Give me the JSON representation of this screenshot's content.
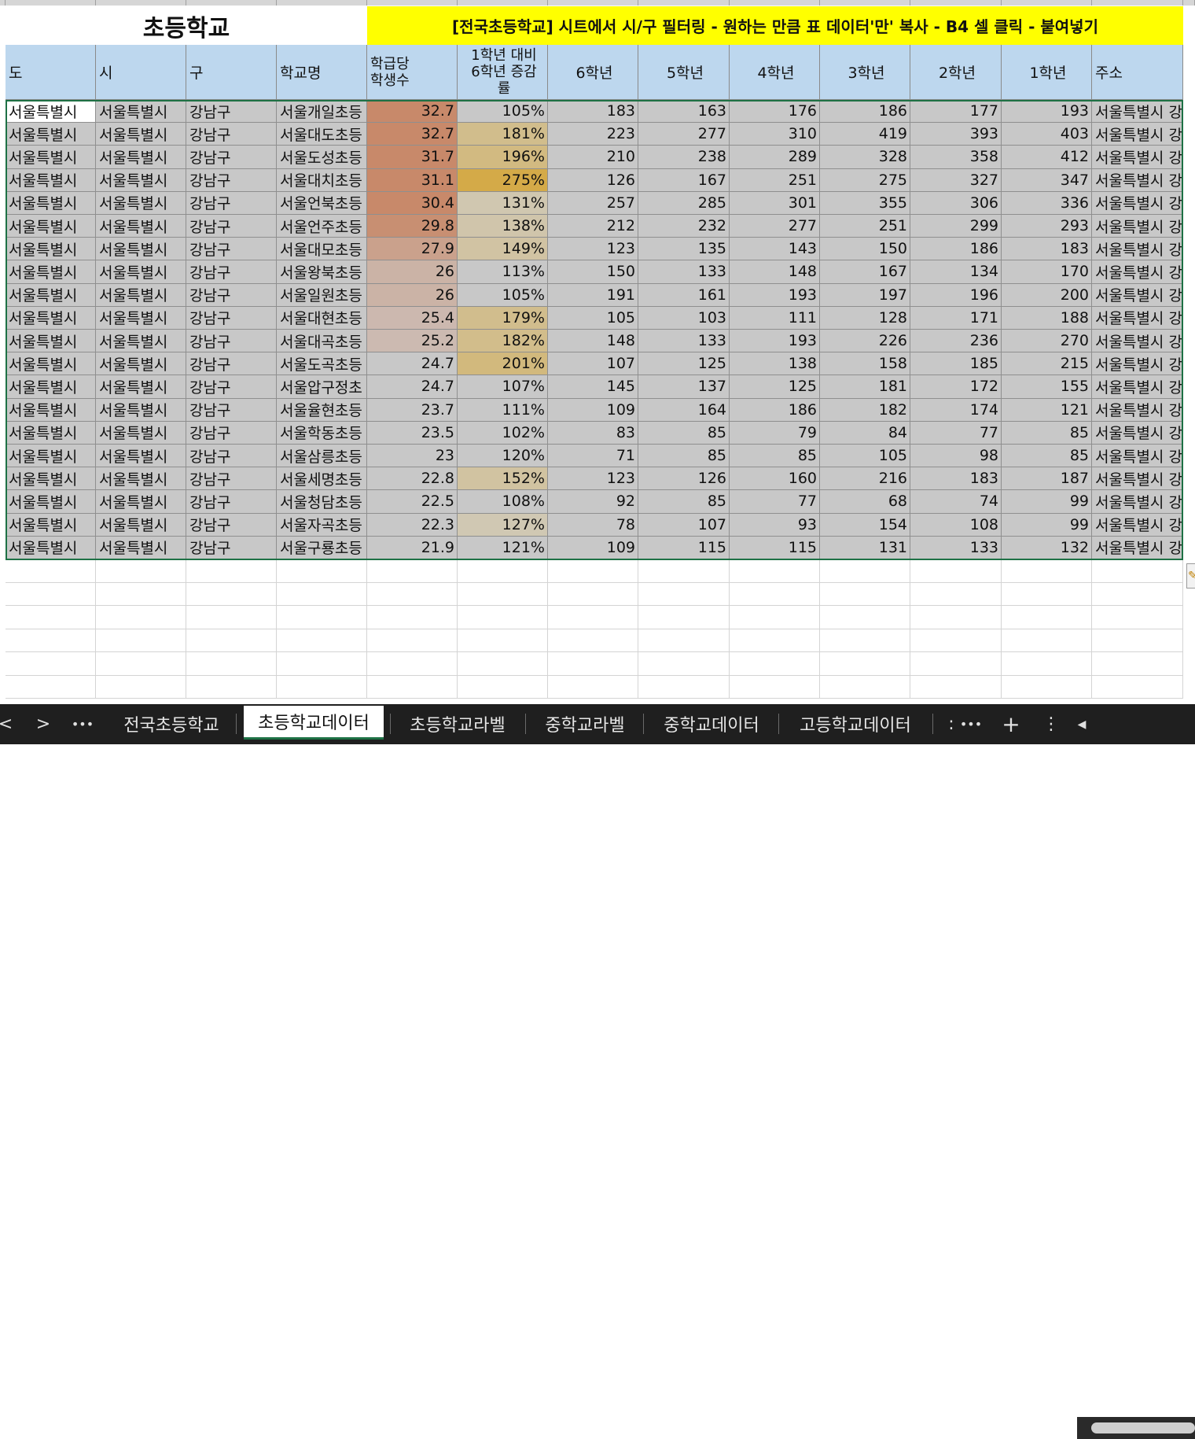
{
  "sheet": {
    "title": "초등학교",
    "banner": "[전국초등학교] 시트에서 시/구 필터링 - 원하는 만큼 표 데이터'만' 복사 - B4 셀 클릭 - 붙여넣기",
    "headers": [
      "도",
      "시",
      "구",
      "학교명",
      "학급당\n학생수",
      "1학년 대비\n6학년 증감\n률",
      "6학년",
      "5학년",
      "4학년",
      "3학년",
      "2학년",
      "1학년",
      "주소"
    ],
    "rows": [
      [
        "서울특별시",
        "서울특별시",
        "강남구",
        "서울개일초등",
        "32.7",
        "105%",
        "183",
        "163",
        "176",
        "186",
        "177",
        "193",
        "서울특별시 강"
      ],
      [
        "서울특별시",
        "서울특별시",
        "강남구",
        "서울대도초등",
        "32.7",
        "181%",
        "223",
        "277",
        "310",
        "419",
        "393",
        "403",
        "서울특별시 강"
      ],
      [
        "서울특별시",
        "서울특별시",
        "강남구",
        "서울도성초등",
        "31.7",
        "196%",
        "210",
        "238",
        "289",
        "328",
        "358",
        "412",
        "서울특별시 강"
      ],
      [
        "서울특별시",
        "서울특별시",
        "강남구",
        "서울대치초등",
        "31.1",
        "275%",
        "126",
        "167",
        "251",
        "275",
        "327",
        "347",
        "서울특별시 강"
      ],
      [
        "서울특별시",
        "서울특별시",
        "강남구",
        "서울언북초등",
        "30.4",
        "131%",
        "257",
        "285",
        "301",
        "355",
        "306",
        "336",
        "서울특별시 강"
      ],
      [
        "서울특별시",
        "서울특별시",
        "강남구",
        "서울언주초등",
        "29.8",
        "138%",
        "212",
        "232",
        "277",
        "251",
        "299",
        "293",
        "서울특별시 강"
      ],
      [
        "서울특별시",
        "서울특별시",
        "강남구",
        "서울대모초등",
        "27.9",
        "149%",
        "123",
        "135",
        "143",
        "150",
        "186",
        "183",
        "서울특별시 강"
      ],
      [
        "서울특별시",
        "서울특별시",
        "강남구",
        "서울왕북초등",
        "26",
        "113%",
        "150",
        "133",
        "148",
        "167",
        "134",
        "170",
        "서울특별시 강"
      ],
      [
        "서울특별시",
        "서울특별시",
        "강남구",
        "서울일원초등",
        "26",
        "105%",
        "191",
        "161",
        "193",
        "197",
        "196",
        "200",
        "서울특별시 강"
      ],
      [
        "서울특별시",
        "서울특별시",
        "강남구",
        "서울대현초등",
        "25.4",
        "179%",
        "105",
        "103",
        "111",
        "128",
        "171",
        "188",
        "서울특별시 강"
      ],
      [
        "서울특별시",
        "서울특별시",
        "강남구",
        "서울대곡초등",
        "25.2",
        "182%",
        "148",
        "133",
        "193",
        "226",
        "236",
        "270",
        "서울특별시 강"
      ],
      [
        "서울특별시",
        "서울특별시",
        "강남구",
        "서울도곡초등",
        "24.7",
        "201%",
        "107",
        "125",
        "138",
        "158",
        "185",
        "215",
        "서울특별시 강"
      ],
      [
        "서울특별시",
        "서울특별시",
        "강남구",
        "서울압구정초",
        "24.7",
        "107%",
        "145",
        "137",
        "125",
        "181",
        "172",
        "155",
        "서울특별시 강"
      ],
      [
        "서울특별시",
        "서울특별시",
        "강남구",
        "서울율현초등",
        "23.7",
        "111%",
        "109",
        "164",
        "186",
        "182",
        "174",
        "121",
        "서울특별시 강"
      ],
      [
        "서울특별시",
        "서울특별시",
        "강남구",
        "서울학동초등",
        "23.5",
        "102%",
        "83",
        "85",
        "79",
        "84",
        "77",
        "85",
        "서울특별시 강"
      ],
      [
        "서울특별시",
        "서울특별시",
        "강남구",
        "서울삼릉초등",
        "23",
        "120%",
        "71",
        "85",
        "85",
        "105",
        "98",
        "85",
        "서울특별시 강"
      ],
      [
        "서울특별시",
        "서울특별시",
        "강남구",
        "서울세명초등",
        "22.8",
        "152%",
        "123",
        "126",
        "160",
        "216",
        "183",
        "187",
        "서울특별시 강"
      ],
      [
        "서울특별시",
        "서울특별시",
        "강남구",
        "서울청담초등",
        "22.5",
        "108%",
        "92",
        "85",
        "77",
        "68",
        "74",
        "99",
        "서울특별시 강"
      ],
      [
        "서울특별시",
        "서울특별시",
        "강남구",
        "서울자곡초등",
        "22.3",
        "127%",
        "78",
        "107",
        "93",
        "154",
        "108",
        "99",
        "서울특별시 강"
      ],
      [
        "서울특별시",
        "서울특별시",
        "강남구",
        "서울구룡초등",
        "21.9",
        "121%",
        "109",
        "115",
        "115",
        "131",
        "133",
        "132",
        "서울특별시 강"
      ]
    ],
    "colors": {
      "header_bg": "#bdd7ee",
      "banner_bg": "#ffff00",
      "data_bg": "#c8c8c8",
      "selection_border": "#1e7145",
      "size_scale_high": "#c8896a",
      "size_scale_low": "#ccbcb4",
      "growth_scale_high": "#d4aa48",
      "growth_scale_low": "#d0c8b4"
    }
  },
  "tabs": {
    "nav_prev": "<",
    "nav_next": ">",
    "more_left": "•••",
    "items": [
      "전국초등학교",
      "초등학교데이터",
      "초등학교라벨",
      "중학교라벨",
      "중학교데이터",
      "고등학교데이터"
    ],
    "active_index": 1,
    "overflow": ":",
    "more_right": "•••",
    "add": "+",
    "menu": "⋮",
    "scroll_left": "◀"
  }
}
